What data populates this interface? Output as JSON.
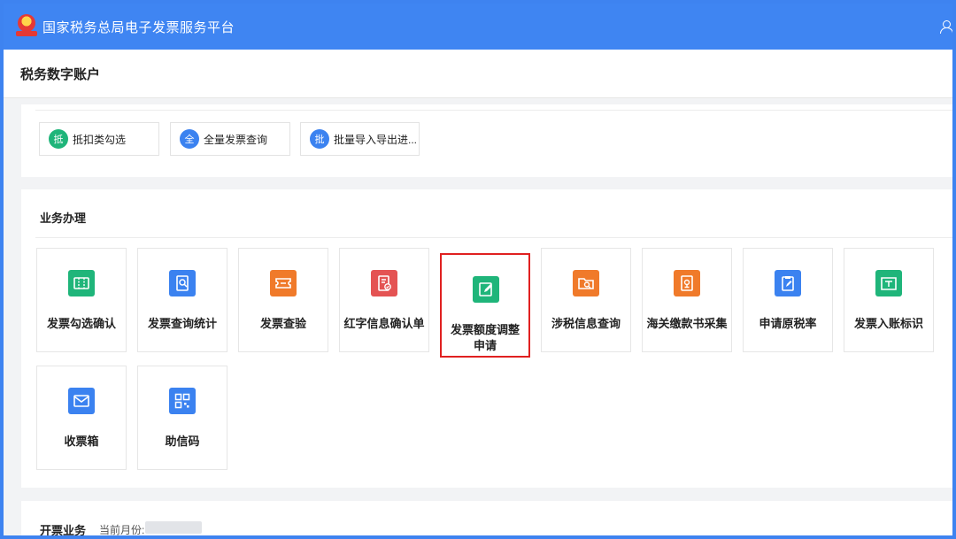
{
  "header": {
    "title": "国家税务总局电子发票服务平台"
  },
  "account": {
    "label": "税务数字账户"
  },
  "shortcuts": [
    {
      "badge": "抵",
      "label": "抵扣类勾选",
      "color": "#1fb57a"
    },
    {
      "badge": "全",
      "label": "全量发票查询",
      "color": "#3b82f0"
    },
    {
      "badge": "批",
      "label": "批量导入导出进...",
      "color": "#3b82f0"
    }
  ],
  "business": {
    "heading": "业务办理",
    "tiles": [
      {
        "name": "发票勾选确认",
        "icon": "ticket-check-icon",
        "color": "#1fb57a"
      },
      {
        "name": "发票查询统计",
        "icon": "document-search-icon",
        "color": "#3b82f0"
      },
      {
        "name": "发票查验",
        "icon": "ticket-icon",
        "color": "#f07a2a"
      },
      {
        "name": "红字信息确认单",
        "icon": "document-check-icon",
        "color": "#e45353"
      },
      {
        "name": "发票额度调整申请",
        "icon": "document-edit-icon",
        "color": "#1fb57a",
        "highlighted": true
      },
      {
        "name": "涉税信息查询",
        "icon": "folder-search-icon",
        "color": "#f07a2a"
      },
      {
        "name": "海关缴款书采集",
        "icon": "document-stamp-icon",
        "color": "#f07a2a"
      },
      {
        "name": "申请原税率",
        "icon": "clipboard-edit-icon",
        "color": "#3b82f0"
      },
      {
        "name": "发票入账标识",
        "icon": "tray-icon",
        "color": "#1fb57a"
      },
      {
        "name": "收票箱",
        "icon": "mail-icon",
        "color": "#3b82f0"
      },
      {
        "name": "助信码",
        "icon": "qr-code-icon",
        "color": "#3b82f0"
      }
    ]
  },
  "issuing": {
    "heading": "开票业务",
    "month_label": "当前月份:"
  }
}
